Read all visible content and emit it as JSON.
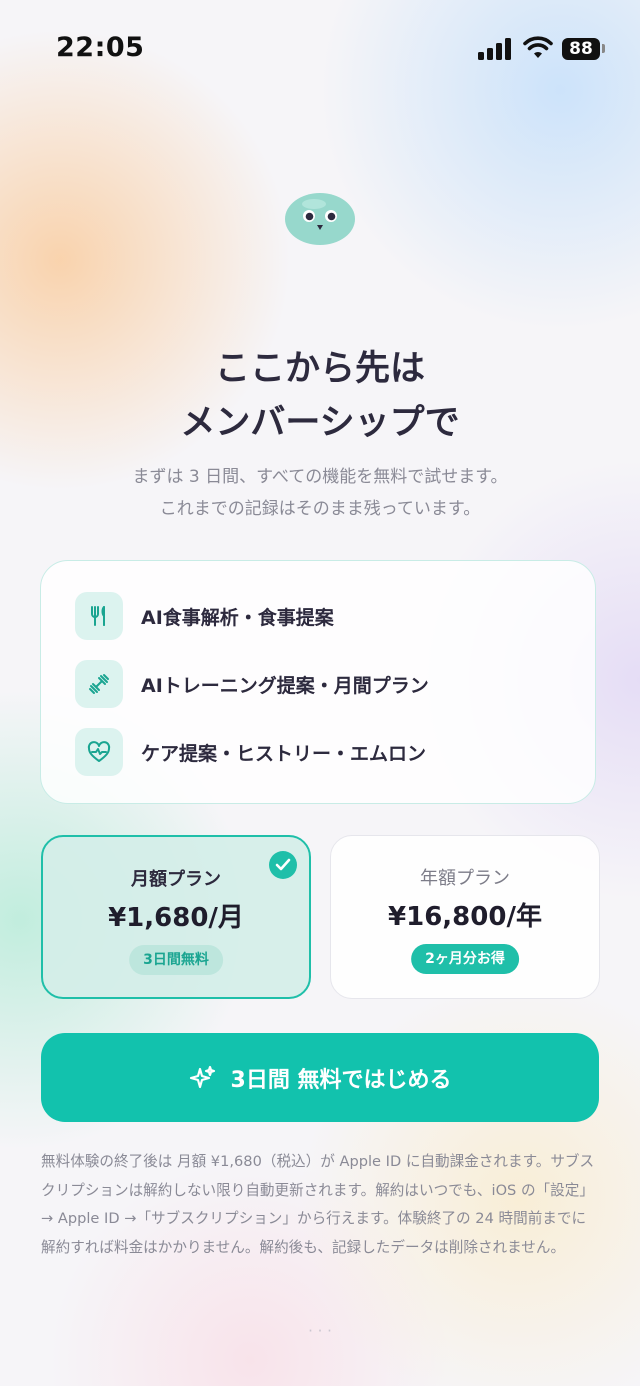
{
  "status_bar": {
    "time": "22:05",
    "battery": "88"
  },
  "heading": {
    "line1": "ここから先は",
    "line2": "メンバーシップで"
  },
  "subtitle": {
    "line1": "まずは 3 日間、すべての機能を無料で試せます。",
    "line2": "これまでの記録はそのまま残っています。"
  },
  "features": [
    {
      "icon": "fork-knife-icon",
      "label": "AI食事解析・食事提案"
    },
    {
      "icon": "dumbbell-icon",
      "label": "AIトレーニング提案・月間プラン"
    },
    {
      "icon": "heart-pulse-icon",
      "label": "ケア提案・ヒストリー・エムロン"
    }
  ],
  "plans": {
    "monthly": {
      "name": "月額プラン",
      "price": "¥1,680/月",
      "badge": "3日間無料",
      "selected": true
    },
    "yearly": {
      "name": "年額プラン",
      "price": "¥16,800/年",
      "badge": "2ヶ月分お得",
      "selected": false
    }
  },
  "cta": {
    "label": "3日間 無料ではじめる",
    "icon": "sparkle-icon"
  },
  "legal": "無料体験の終了後は 月額 ¥1,680（税込）が Apple ID に自動課金されます。サブスクリプションは解約しない限り自動更新されます。解約はいつでも、iOS の「設定」→ Apple ID →「サブスクリプション」から行えます。体験終了の 24 時間前までに解約すれば料金はかかりません。解約後も、記録したデータは削除されません。",
  "colors": {
    "accent": "#12c2ad",
    "accent_light": "#dcf3ef",
    "title_text": "#2d2a3e",
    "muted_text": "#8a8a96"
  }
}
